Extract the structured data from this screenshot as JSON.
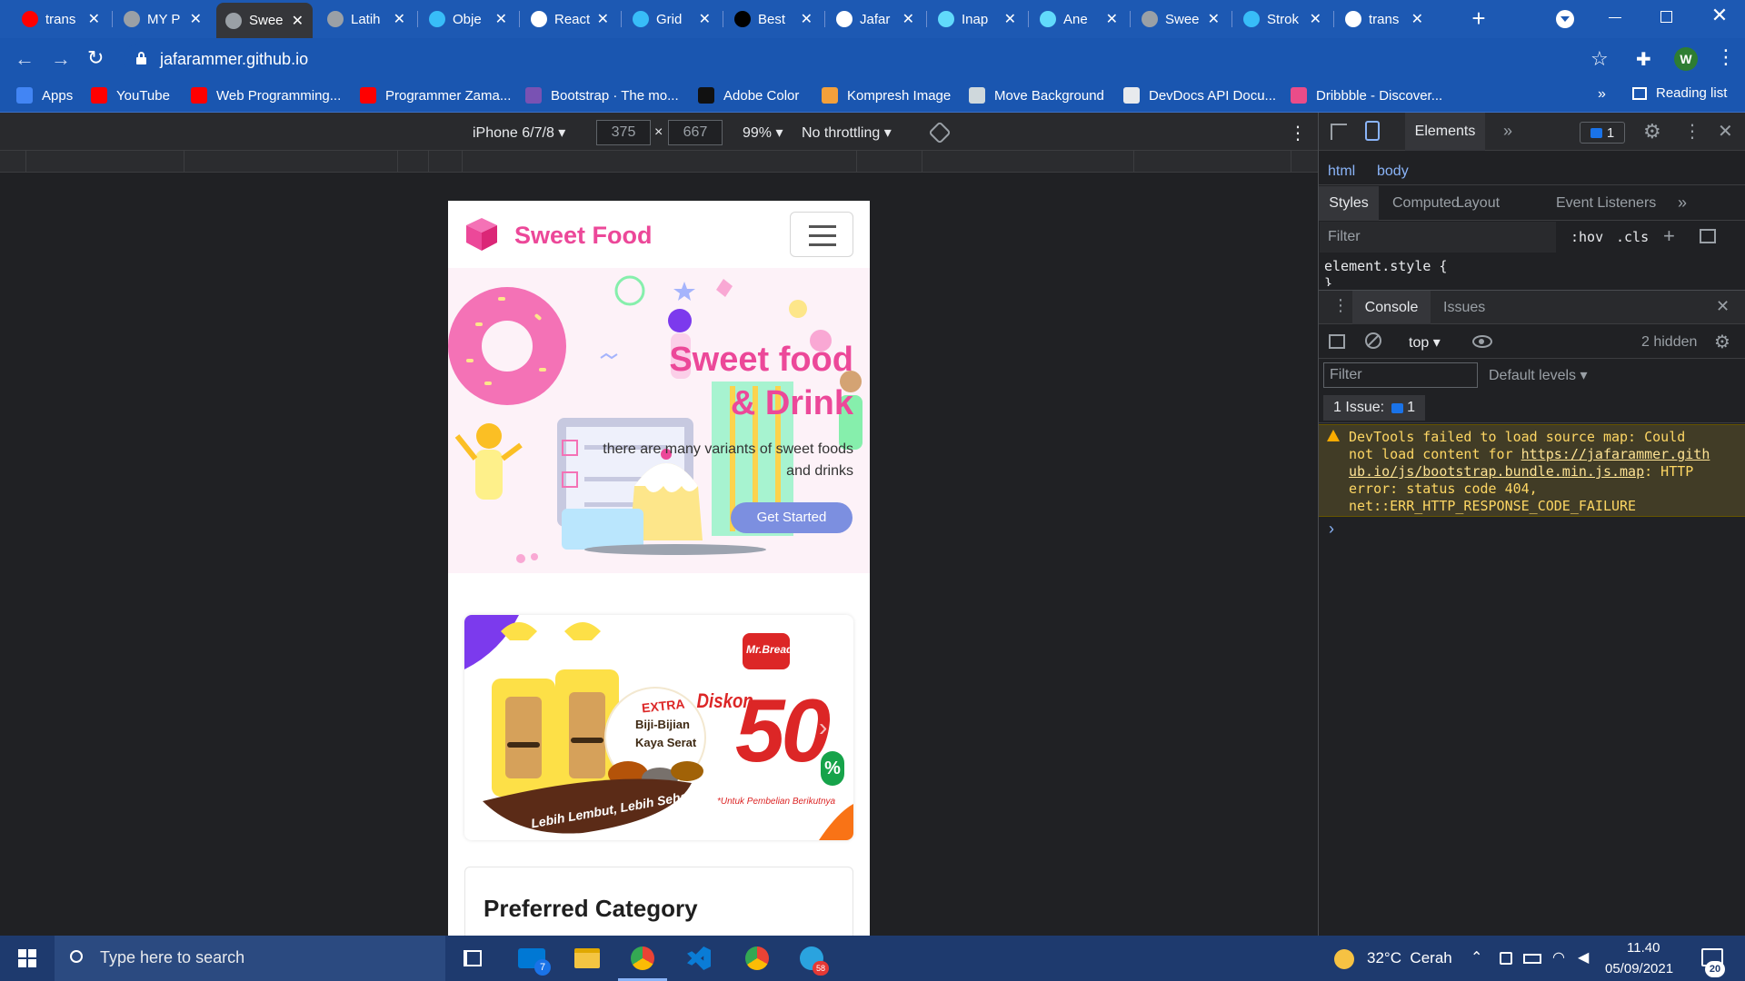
{
  "browser": {
    "tabs": [
      {
        "title": "trans",
        "favicon": "youtube-icon",
        "color": "#ff0000"
      },
      {
        "title": "MY P",
        "favicon": "globe-icon",
        "color": "#9aa0a6"
      },
      {
        "title": "Swee",
        "favicon": "globe-icon",
        "color": "#9aa0a6",
        "active": true
      },
      {
        "title": "Latih",
        "favicon": "globe-icon",
        "color": "#9aa0a6"
      },
      {
        "title": "Obje",
        "favicon": "tailwind-icon",
        "color": "#38bdf8"
      },
      {
        "title": "React",
        "favicon": "flag-icon",
        "color": "#ffffff"
      },
      {
        "title": "Grid",
        "favicon": "tailwind-icon",
        "color": "#38bdf8"
      },
      {
        "title": "Best",
        "favicon": "dev-icon",
        "color": "#000000"
      },
      {
        "title": "Jafar",
        "favicon": "github-icon",
        "color": "#ffffff"
      },
      {
        "title": "Inap",
        "favicon": "react-icon",
        "color": "#61dafb"
      },
      {
        "title": "Ane",
        "favicon": "react-icon",
        "color": "#61dafb"
      },
      {
        "title": "Swee",
        "favicon": "globe-icon",
        "color": "#9aa0a6"
      },
      {
        "title": "Strok",
        "favicon": "tailwind-icon",
        "color": "#38bdf8"
      },
      {
        "title": "trans",
        "favicon": "google-icon",
        "color": "#ffffff"
      }
    ],
    "url": "jafarammer.github.io",
    "profile_initial": "W",
    "bookmarks": [
      {
        "label": "Apps",
        "icon": "apps-grid-icon",
        "color": "#4285f4"
      },
      {
        "label": "YouTube",
        "icon": "youtube-icon",
        "color": "#ff0000"
      },
      {
        "label": "Web Programming...",
        "icon": "youtube-icon",
        "color": "#ff0000"
      },
      {
        "label": "Programmer Zama...",
        "icon": "youtube-icon",
        "color": "#ff0000"
      },
      {
        "label": "Bootstrap · The mo...",
        "icon": "bootstrap-icon",
        "color": "#7952b3"
      },
      {
        "label": "Adobe Color",
        "icon": "adobe-color-icon",
        "color": "#111111"
      },
      {
        "label": "Kompresh Image",
        "icon": "compress-icon",
        "color": "#f3a03b"
      },
      {
        "label": "Move Background",
        "icon": "layers-icon",
        "color": "#cfd8dc"
      },
      {
        "label": "DevDocs API Docu...",
        "icon": "devdocs-icon",
        "color": "#e8eaed"
      },
      {
        "label": "Dribbble - Discover...",
        "icon": "dribbble-icon",
        "color": "#ea4c89"
      }
    ],
    "reading_list": "Reading list",
    "more_bookmarks": "»"
  },
  "device_toolbar": {
    "device": "iPhone 6/7/8",
    "width": "375",
    "times": "×",
    "height": "667",
    "zoom": "99%",
    "throttle": "No throttling"
  },
  "site": {
    "brand": "Sweet Food",
    "hero_title_1": "Sweet food",
    "hero_title_2": "& Drink",
    "hero_sub_1": "there are many variants of sweet foods",
    "hero_sub_2": "and drinks",
    "cta": "Get Started",
    "promo_brand": "Mr.Bread",
    "promo_extra": "EXTRA",
    "promo_biji": "Biji-Bijian",
    "promo_kaya": "Kaya Serat",
    "promo_diskon": "Diskon",
    "promo_value": "50",
    "promo_pct": "%",
    "promo_note": "*Untuk Pembelian Berikutnya",
    "promo_tagline": "Lebih Lembut, Lebih Sehat",
    "section_title": "Preferred Category",
    "brand_color": "#ec4899"
  },
  "devtools": {
    "top_tabs": {
      "elements": "Elements",
      "more": "»",
      "issues_count": "1"
    },
    "breadcrumb": [
      "html",
      "body"
    ],
    "style_tabs": [
      "Styles",
      "Computed",
      "Layout",
      "Event Listeners"
    ],
    "filter_placeholder": "Filter",
    "hov": ":hov",
    "cls": ".cls",
    "element_style": "element.style {",
    "close_brace": "}",
    "drawer_tabs": [
      "Console",
      "Issues"
    ],
    "context": "top",
    "hidden": "2 hidden",
    "console_filter": "Filter",
    "levels": "Default levels",
    "issue_label": "1 Issue:",
    "issue_count": "1",
    "warning_lines": [
      "DevTools failed to load source map: Could",
      "not load content for "
    ],
    "warning_link_1": "https://jafarammer.gith",
    "warning_link_2": "ub.io/js/bootstrap.bundle.min.js.map",
    "warning_after_link": ": HTTP",
    "warning_line_4": "error: status code 404,",
    "warning_line_5": "net::ERR_HTTP_RESPONSE_CODE_FAILURE",
    "prompt": "›"
  },
  "taskbar": {
    "search_placeholder": "Type here to search",
    "mail_badge": "7",
    "telegram_badge": "58",
    "weather": "32°C  Cerah",
    "time": "11.40",
    "date": "05/09/2021",
    "notif": "20"
  }
}
